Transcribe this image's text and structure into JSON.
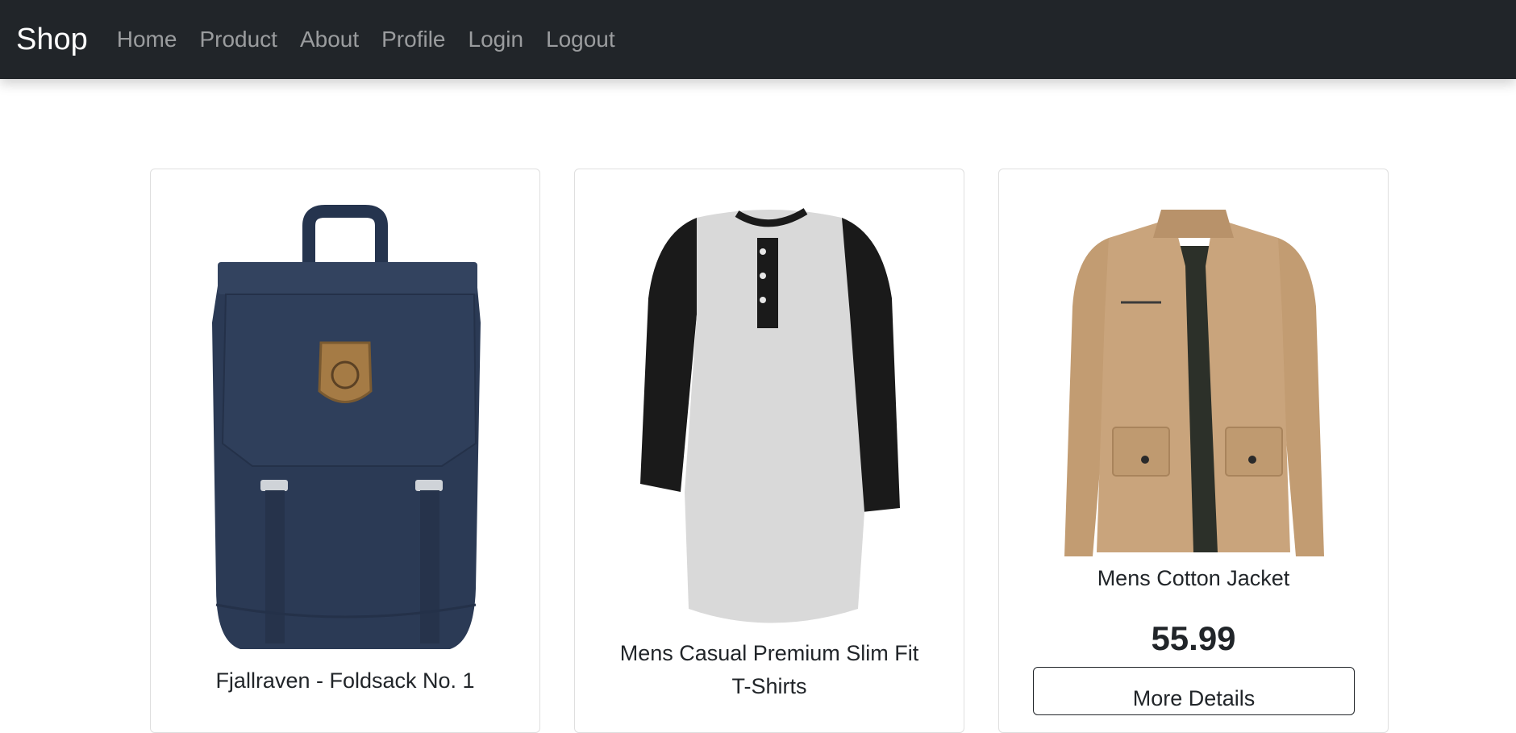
{
  "navbar": {
    "brand": "Shop",
    "links": [
      "Home",
      "Product",
      "About",
      "Profile",
      "Login",
      "Logout"
    ]
  },
  "products": [
    {
      "title": "Fjallraven - Foldsack No. 1",
      "image": "navy-backpack-image"
    },
    {
      "title_line1": "Mens Casual Premium Slim Fit",
      "title_line2": "T-Shirts",
      "image": "raglan-henley-tshirt-image"
    },
    {
      "title": "Mens Cotton Jacket",
      "price": "55.99",
      "button": "More Details",
      "image": "khaki-cotton-jacket-image"
    }
  ],
  "colors": {
    "navbar_bg": "#212529",
    "backpack": "#2b3a55",
    "jacket": "#c9a47c"
  }
}
